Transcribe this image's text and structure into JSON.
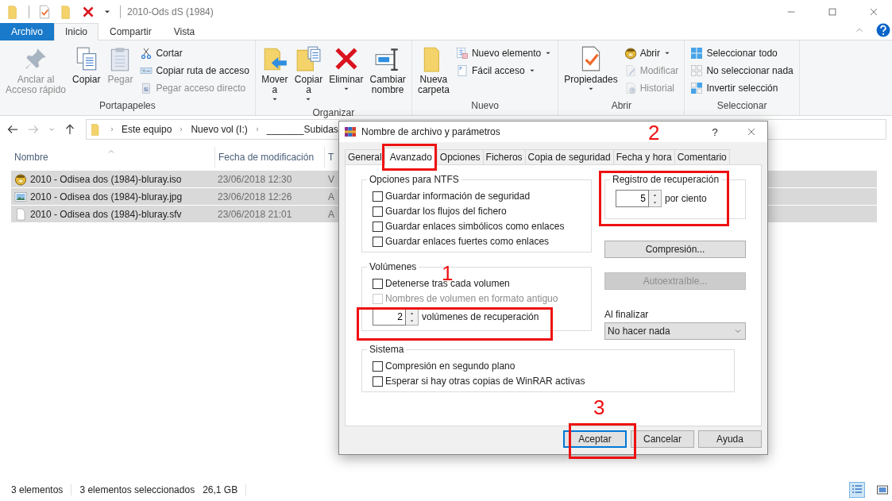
{
  "window": {
    "title": "2010-Ods dS (1984)"
  },
  "ribbon_tabs": [
    {
      "label": "Archivo",
      "kind": "file",
      "selected": false
    },
    {
      "label": "Inicio",
      "kind": "tab",
      "selected": true
    },
    {
      "label": "Compartir",
      "kind": "tab",
      "selected": false
    },
    {
      "label": "Vista",
      "kind": "tab",
      "selected": false
    }
  ],
  "ribbon_groups": [
    {
      "label": "Portapapeles",
      "items": [
        {
          "label": "Anclar al\nAcceso rápido",
          "kind": "large",
          "disabled": true,
          "menu": false
        },
        {
          "label": "Copiar",
          "kind": "large",
          "disabled": false,
          "menu": false
        },
        {
          "label": "Pegar",
          "kind": "large",
          "disabled": true,
          "menu": false
        },
        {
          "label": "Cortar",
          "kind": "small",
          "disabled": false,
          "menu": false
        },
        {
          "label": "Copiar ruta de acceso",
          "kind": "small",
          "disabled": false,
          "menu": false
        },
        {
          "label": "Pegar acceso directo",
          "kind": "small",
          "disabled": true,
          "menu": false
        }
      ]
    },
    {
      "label": "Organizar",
      "items": [
        {
          "label": "Mover\na",
          "kind": "large",
          "disabled": false,
          "menu": true
        },
        {
          "label": "Copiar\na",
          "kind": "large",
          "disabled": false,
          "menu": true
        },
        {
          "label": "Eliminar",
          "kind": "large",
          "disabled": false,
          "menu": true
        },
        {
          "label": "Cambiar\nnombre",
          "kind": "large",
          "disabled": false,
          "menu": false
        }
      ]
    },
    {
      "label": "Nuevo",
      "items": [
        {
          "label": "Nueva\ncarpeta",
          "kind": "large",
          "disabled": false,
          "menu": false
        },
        {
          "label": "Nuevo elemento",
          "kind": "small",
          "disabled": false,
          "menu": true
        },
        {
          "label": "Fácil acceso",
          "kind": "small",
          "disabled": false,
          "menu": true
        }
      ]
    },
    {
      "label": "Abrir",
      "items": [
        {
          "label": "Propiedades",
          "kind": "large",
          "disabled": false,
          "menu": true
        },
        {
          "label": "Abrir",
          "kind": "small",
          "disabled": false,
          "menu": true
        },
        {
          "label": "Modificar",
          "kind": "small",
          "disabled": true,
          "menu": false
        },
        {
          "label": "Historial",
          "kind": "small",
          "disabled": true,
          "menu": false
        }
      ]
    },
    {
      "label": "Seleccionar",
      "items": [
        {
          "label": "Seleccionar todo",
          "kind": "small",
          "disabled": false,
          "menu": false
        },
        {
          "label": "No seleccionar nada",
          "kind": "small",
          "disabled": false,
          "menu": false
        },
        {
          "label": "Invertir selección",
          "kind": "small",
          "disabled": false,
          "menu": false
        }
      ]
    }
  ],
  "address_bar": {
    "crumbs": [
      "Este equipo",
      "Nuevo vol (I:)",
      "_______Subidas"
    ]
  },
  "file_list": {
    "columns": [
      {
        "label": "Nombre",
        "sorted": true
      },
      {
        "label": "Fecha de modificación",
        "sorted": false
      },
      {
        "label": "T",
        "sorted": false
      }
    ],
    "rows": [
      {
        "name": "2010 - Odisea dos (1984)-bluray.iso",
        "date": "23/06/2018 12:30",
        "column_3": "V",
        "selected": true
      },
      {
        "name": "2010 - Odisea dos (1984)-bluray.jpg",
        "date": "23/06/2018 12:26",
        "column_3": "A",
        "selected": true
      },
      {
        "name": "2010 - Odisea dos (1984)-bluray.sfv",
        "date": "23/06/2018 21:01",
        "column_3": "A",
        "selected": true
      }
    ]
  },
  "status_bar": {
    "count": "3 elementos",
    "selection": "3 elementos seleccionados",
    "size": "26,1 GB"
  },
  "dialog": {
    "title": "Nombre de archivo y parámetros",
    "help": "?",
    "tabs": [
      {
        "label": "General",
        "selected": false
      },
      {
        "label": "Avanzado",
        "selected": true
      },
      {
        "label": "Opciones",
        "selected": false
      },
      {
        "label": "Ficheros",
        "selected": false
      },
      {
        "label": "Copia de seguridad",
        "selected": false
      },
      {
        "label": "Fecha y hora",
        "selected": false
      },
      {
        "label": "Comentario",
        "selected": false
      }
    ],
    "ntfs": {
      "label": "Opciones para NTFS",
      "options": [
        {
          "label": "Guardar información de seguridad",
          "checked": false,
          "disabled": false
        },
        {
          "label": "Guardar los flujos del fichero",
          "checked": false,
          "disabled": false
        },
        {
          "label": "Guardar enlaces simbólicos como enlaces",
          "checked": false,
          "disabled": false
        },
        {
          "label": "Guardar enlaces fuertes como enlaces",
          "checked": false,
          "disabled": false
        }
      ]
    },
    "volumes": {
      "label": "Volúmenes",
      "options": [
        {
          "label": "Detenerse tras cada volumen",
          "checked": false,
          "disabled": false
        },
        {
          "label": "Nombres de volumen en formato antiguo",
          "checked": false,
          "disabled": true
        }
      ],
      "recovery_volumes": {
        "value": "2",
        "label": "volúmenes de recuperación"
      }
    },
    "system": {
      "label": "Sistema",
      "options": [
        {
          "label": "Compresión en segundo plano",
          "checked": false,
          "disabled": false
        },
        {
          "label": "Esperar si hay otras copias de WinRAR activas",
          "checked": false,
          "disabled": false
        }
      ]
    },
    "recovery_record": {
      "label": "Registro de recuperación",
      "value": "5",
      "unit": "por ciento"
    },
    "side_buttons": [
      {
        "label": "Compresión...",
        "disabled": false
      },
      {
        "label": "Autoextraíble...",
        "disabled": true
      }
    ],
    "on_finish": {
      "label": "Al finalizar",
      "value": "No hacer nada"
    },
    "buttons": [
      {
        "label": "Aceptar",
        "default": true
      },
      {
        "label": "Cancelar",
        "default": false
      },
      {
        "label": "Ayuda",
        "default": false
      }
    ]
  },
  "annotations": [
    {
      "label": "1"
    },
    {
      "label": "2"
    },
    {
      "label": "3"
    }
  ]
}
